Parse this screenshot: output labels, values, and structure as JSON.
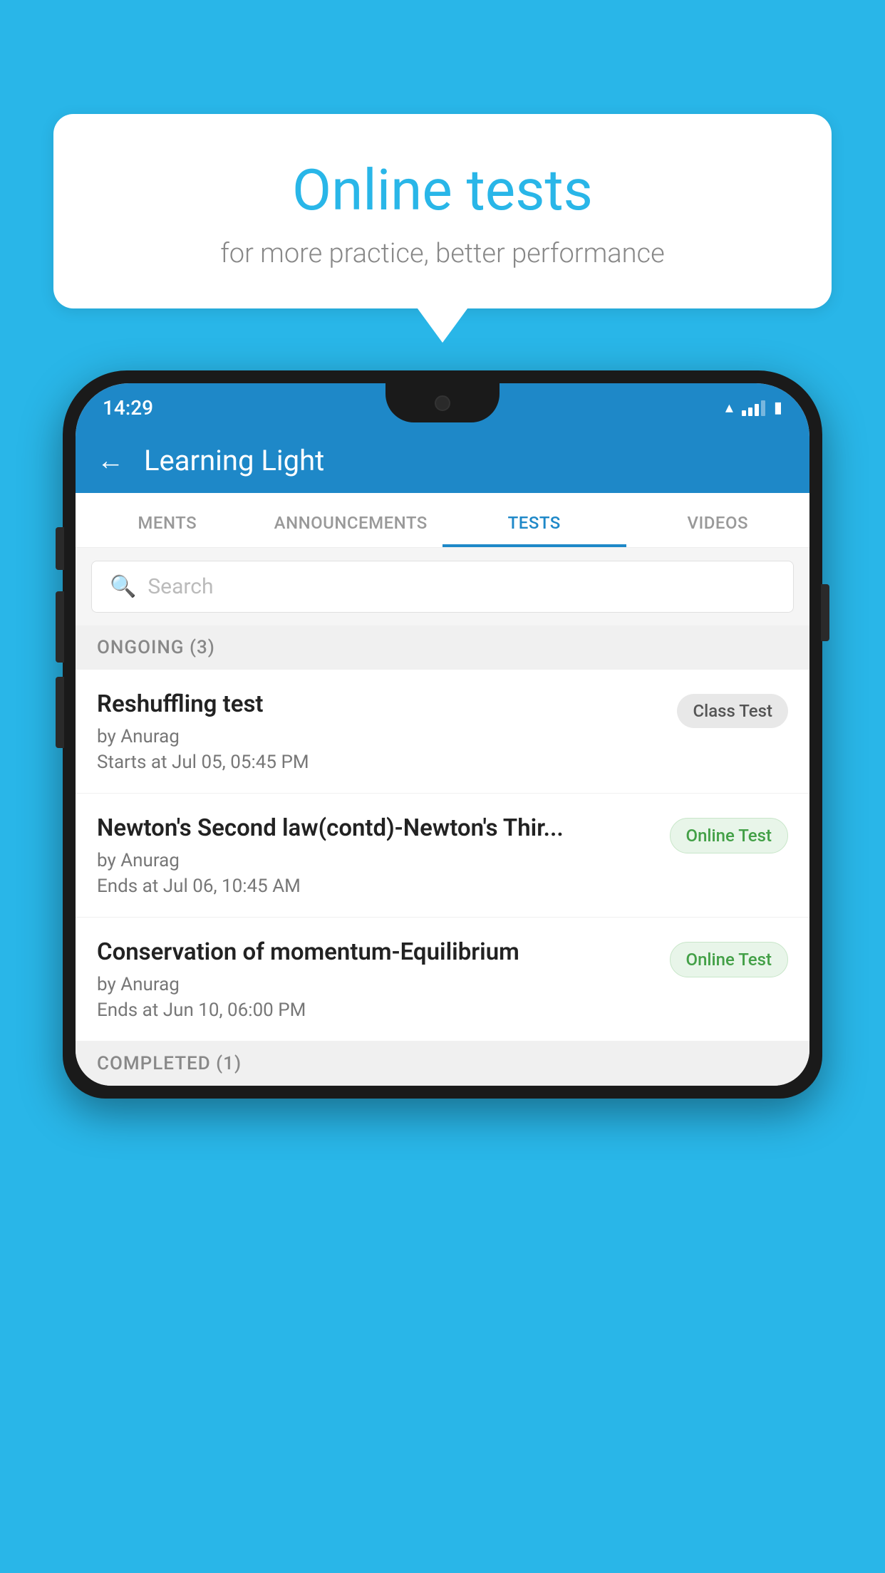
{
  "background": {
    "color": "#29b6e8"
  },
  "speech_bubble": {
    "title": "Online tests",
    "subtitle": "for more practice, better performance"
  },
  "phone": {
    "status_bar": {
      "time": "14:29"
    },
    "app_header": {
      "title": "Learning Light"
    },
    "tabs": [
      {
        "label": "MENTS",
        "active": false
      },
      {
        "label": "ANNOUNCEMENTS",
        "active": false
      },
      {
        "label": "TESTS",
        "active": true
      },
      {
        "label": "VIDEOS",
        "active": false
      }
    ],
    "search": {
      "placeholder": "Search"
    },
    "ongoing_section": {
      "header": "ONGOING (3)"
    },
    "test_items": [
      {
        "title": "Reshuffling test",
        "author": "by Anurag",
        "date": "Starts at  Jul 05, 05:45 PM",
        "badge": "Class Test",
        "badge_type": "class"
      },
      {
        "title": "Newton's Second law(contd)-Newton's Thir...",
        "author": "by Anurag",
        "date": "Ends at  Jul 06, 10:45 AM",
        "badge": "Online Test",
        "badge_type": "online"
      },
      {
        "title": "Conservation of momentum-Equilibrium",
        "author": "by Anurag",
        "date": "Ends at  Jun 10, 06:00 PM",
        "badge": "Online Test",
        "badge_type": "online"
      }
    ],
    "completed_section": {
      "header": "COMPLETED (1)"
    }
  }
}
